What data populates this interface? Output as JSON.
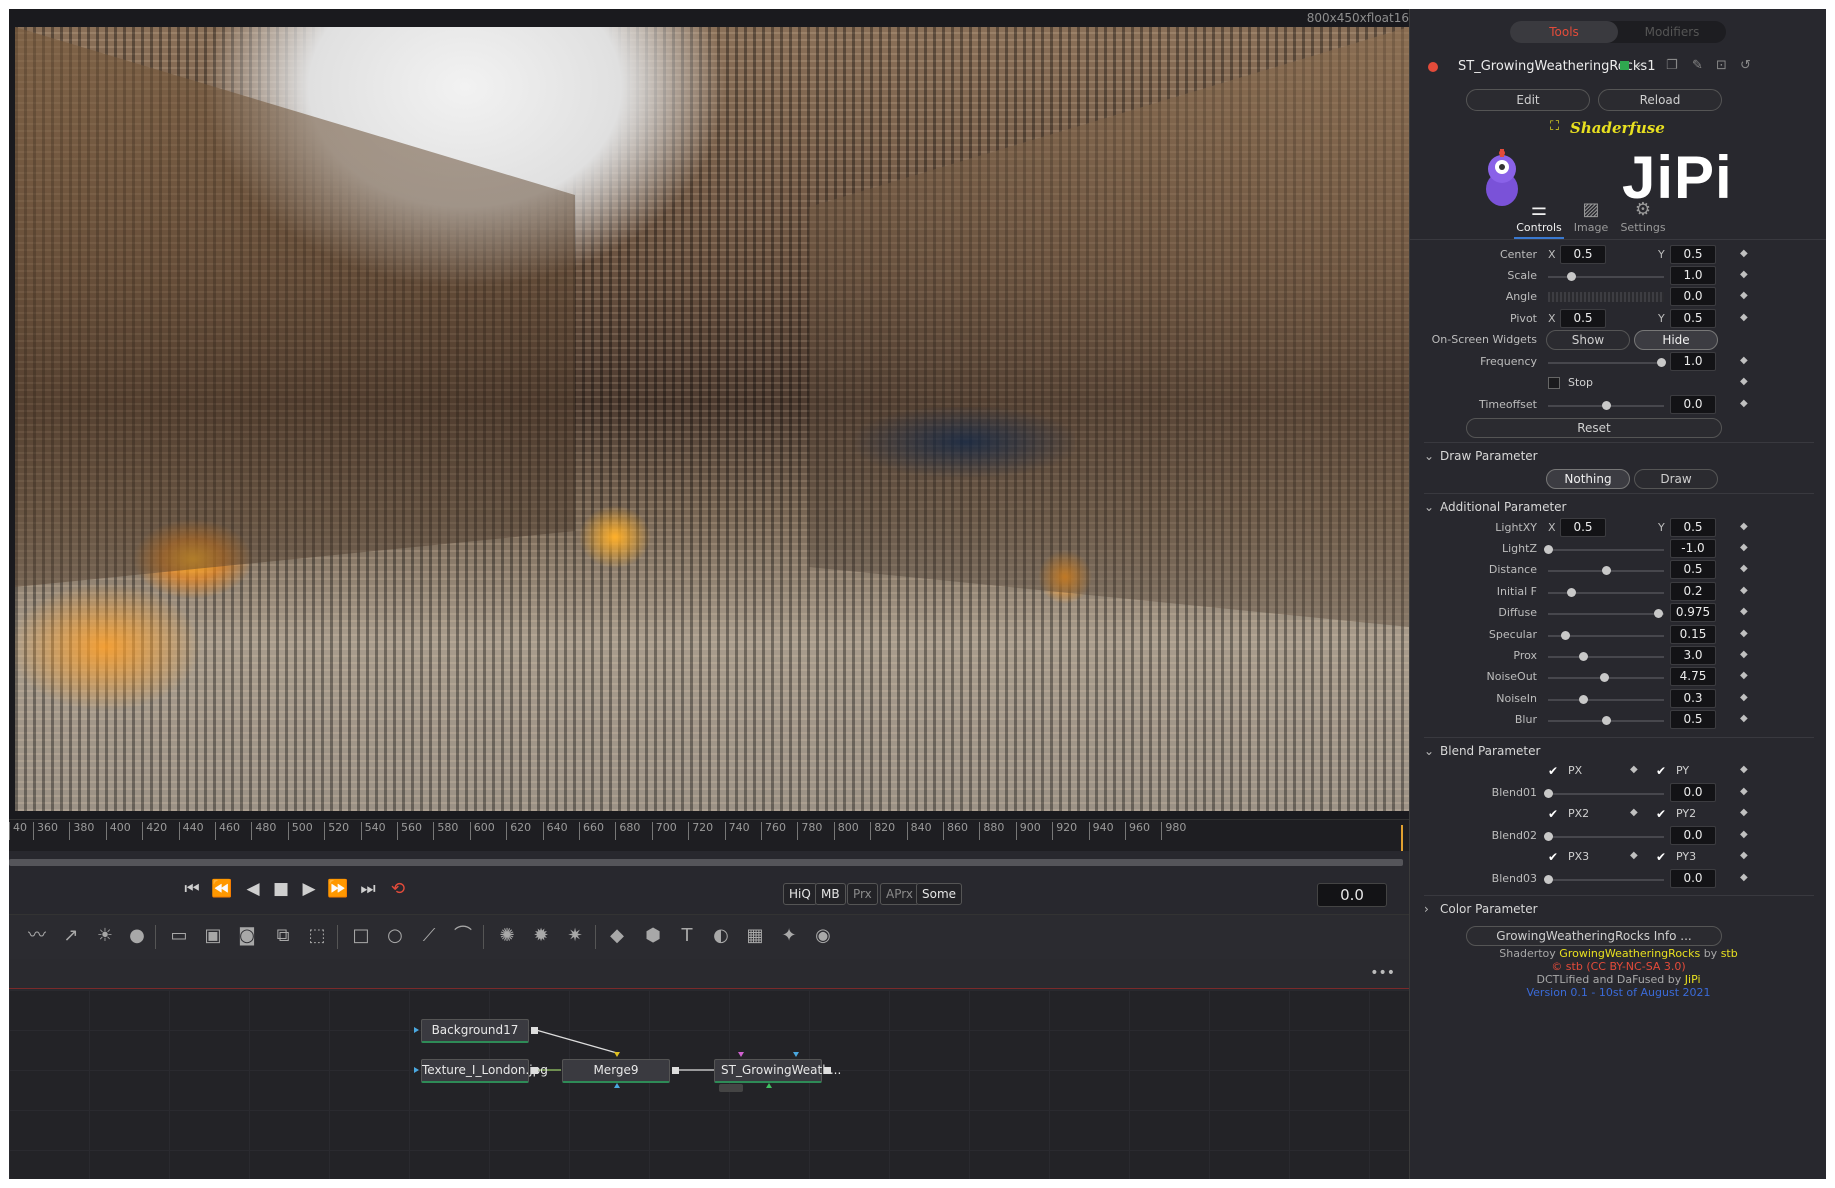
{
  "viewer": {
    "resolution": "800x450xfloat16",
    "ruler_ticks": [
      "40",
      "360",
      "380",
      "400",
      "420",
      "440",
      "460",
      "480",
      "500",
      "520",
      "540",
      "560",
      "580",
      "600",
      "620",
      "640",
      "660",
      "680",
      "700",
      "720",
      "740",
      "760",
      "780",
      "800",
      "820",
      "840",
      "860",
      "880",
      "900",
      "920",
      "940",
      "960",
      "980"
    ]
  },
  "transport": {
    "buttons": [
      {
        "name": "go-to-start",
        "glyph": "⏮"
      },
      {
        "name": "step-back-key",
        "glyph": "⏪"
      },
      {
        "name": "play-reverse",
        "glyph": "◀"
      },
      {
        "name": "stop",
        "glyph": "■"
      },
      {
        "name": "play",
        "glyph": "▶"
      },
      {
        "name": "step-forward-key",
        "glyph": "⏩"
      },
      {
        "name": "go-to-end",
        "glyph": "⏭"
      },
      {
        "name": "loop",
        "glyph": "⟲"
      }
    ],
    "quality_buttons": [
      "HiQ",
      "MB",
      "Prx",
      "APrx",
      "Some"
    ],
    "time": "0.0"
  },
  "nodes": {
    "background": "Background17",
    "texture": "Texture_I_London.jpg",
    "merge": "Merge9",
    "shader": "ST_GrowingWeath..."
  },
  "panel": {
    "tabs": [
      "Tools",
      "Modifiers"
    ],
    "tool_name": "ST_GrowingWeatheringRocks1",
    "edit": "Edit",
    "reload": "Reload",
    "brand": "Shaderfuse",
    "logo": "JiPi",
    "subtabs": [
      "Controls",
      "Image",
      "Settings"
    ],
    "center": {
      "label": "Center",
      "x": "0.5",
      "y": "0.5"
    },
    "scale": {
      "label": "Scale",
      "value": "1.0",
      "pos": 0.2
    },
    "angle": {
      "label": "Angle",
      "value": "0.0"
    },
    "pivot": {
      "label": "Pivot",
      "x": "0.5",
      "y": "0.5"
    },
    "widgets": {
      "label": "On-Screen Widgets",
      "show": "Show",
      "hide": "Hide"
    },
    "frequency": {
      "label": "Frequency",
      "value": "1.0",
      "pos": 0.97
    },
    "stop": "Stop",
    "timeoffset": {
      "label": "Timeoffset",
      "value": "0.0",
      "pos": 0.5
    },
    "reset": "Reset",
    "draw_section": "Draw Parameter",
    "draw_nothing": "Nothing",
    "draw_draw": "Draw",
    "additional_section": "Additional Parameter",
    "lightxy": {
      "label": "LightXY",
      "x": "0.5",
      "y": "0.5"
    },
    "params": [
      {
        "label": "LightZ",
        "value": "-1.0",
        "pos": 0.0
      },
      {
        "label": "Distance",
        "value": "0.5",
        "pos": 0.5
      },
      {
        "label": "Initial F",
        "value": "0.2",
        "pos": 0.2
      },
      {
        "label": "Diffuse",
        "value": "0.975",
        "pos": 0.95
      },
      {
        "label": "Specular",
        "value": "0.15",
        "pos": 0.15
      },
      {
        "label": "Prox",
        "value": "3.0",
        "pos": 0.3
      },
      {
        "label": "NoiseOut",
        "value": "4.75",
        "pos": 0.48
      },
      {
        "label": "NoiseIn",
        "value": "0.3",
        "pos": 0.3
      },
      {
        "label": "Blur",
        "value": "0.5",
        "pos": 0.5
      }
    ],
    "blend_section": "Blend Parameter",
    "blend": [
      {
        "a": "PX",
        "b": "PY",
        "label": "Blend01",
        "value": "0.0"
      },
      {
        "a": "PX2",
        "b": "PY2",
        "label": "Blend02",
        "value": "0.0"
      },
      {
        "a": "PX3",
        "b": "PY3",
        "label": "Blend03",
        "value": "0.0"
      }
    ],
    "color_section": "Color Parameter",
    "info_button": "GrowingWeatheringRocks Info ...",
    "credits": {
      "l1a": "Shadertoy",
      "l1b": "GrowingWeatheringRocks",
      "l1c": "by",
      "l1d": "stb",
      "l2": "© stb (CC BY-NC-SA 3.0)",
      "l3a": "DCTLified and DaFused by",
      "l3b": "JiPi",
      "l4": "Version 0.1 - 10st of August 2021"
    }
  },
  "colors": {
    "accent": "#e34b3a",
    "brand": "#e8e020",
    "link": "#3a6ad8",
    "node_ok": "#2e8b57"
  }
}
